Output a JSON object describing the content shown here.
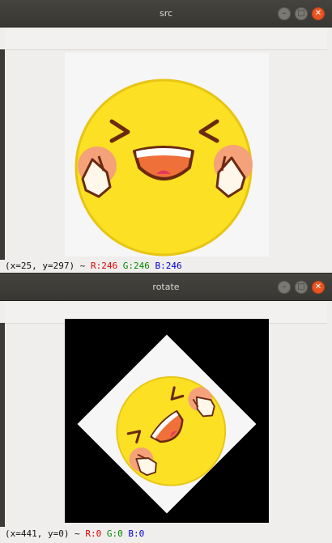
{
  "windows": {
    "src": {
      "title": "src",
      "status": {
        "coords": "(x=25, y=297) ~ ",
        "r": "R:246",
        "g": "G:246",
        "b": "B:246"
      }
    },
    "rotate": {
      "title": "rotate",
      "status": {
        "coords": "(x=441, y=0) ~ ",
        "r": "R:0",
        "g": "G:0",
        "b": "B:0"
      }
    }
  },
  "icons": {
    "minimize": "minimize-icon",
    "maximize": "maximize-icon",
    "close": "close-icon"
  },
  "colors": {
    "face": "#fbe023",
    "cheek": "#f5a17a",
    "mouth": "#f0703a",
    "titlebar": "#3e3d39",
    "close": "#e95420"
  }
}
